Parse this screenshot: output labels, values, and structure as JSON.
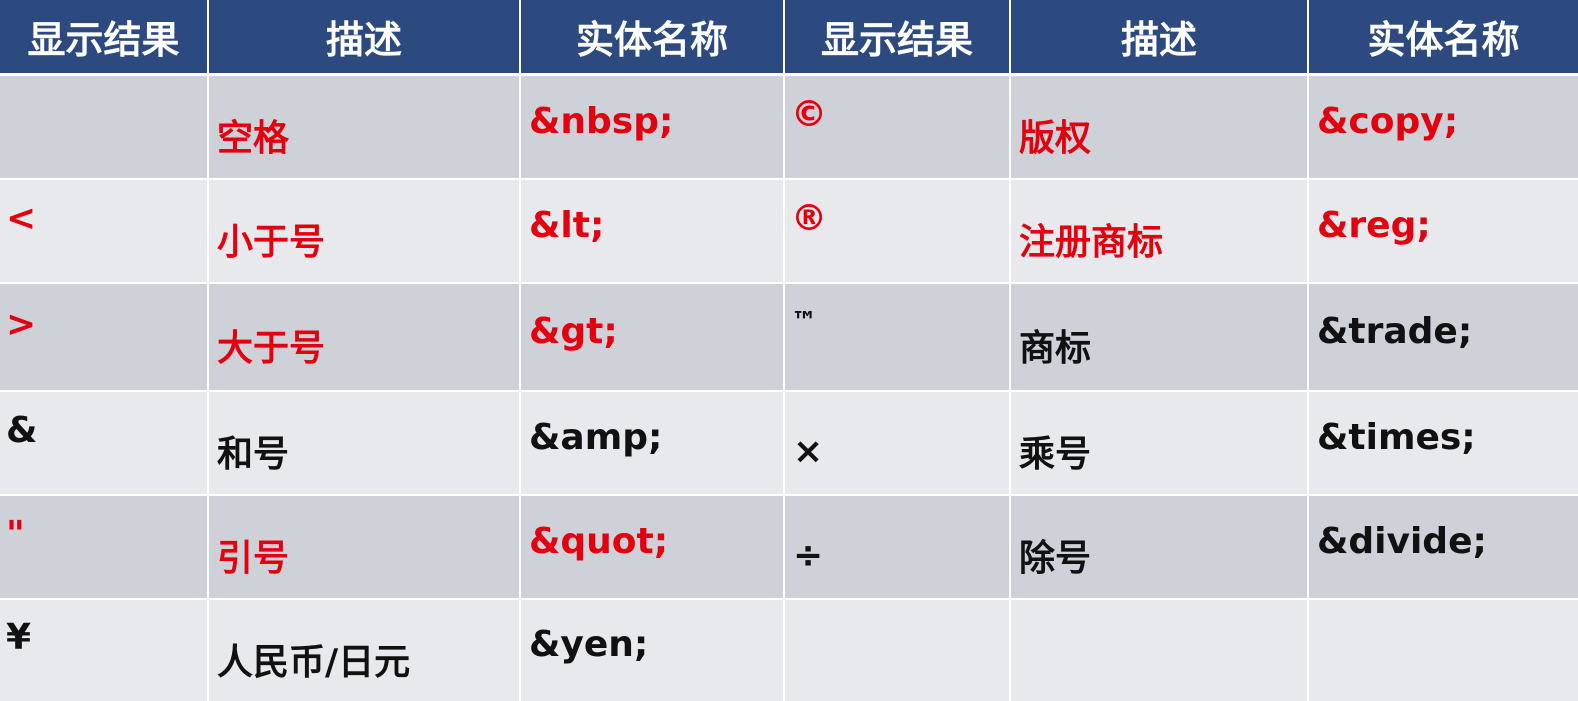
{
  "header": [
    "显示结果",
    "描述",
    "实体名称",
    "显示结果",
    "描述",
    "实体名称"
  ],
  "rows": [
    [
      "",
      "空格",
      "&nbsp;",
      "©",
      "版权",
      "&copy;"
    ],
    [
      "<",
      "小于号",
      "&lt;",
      "®",
      "注册商标",
      "&reg;"
    ],
    [
      ">",
      "大于号",
      "&gt;",
      "™",
      "商标",
      "&trade;"
    ],
    [
      "&",
      "和号",
      "&amp;",
      "×",
      "乘号",
      "&times;"
    ],
    [
      "\"",
      "引号",
      "&quot;",
      "÷",
      "除号",
      "&divide;"
    ],
    [
      "¥",
      "人民币/日元",
      "&yen;",
      "",
      "",
      ""
    ]
  ],
  "colors": {
    "header_bg": "#2c4a7f",
    "header_text": "#ffffff",
    "row_odd": "#cfd1d8",
    "row_even": "#e8e9ec",
    "highlight_text": "#e3000f",
    "normal_text": "#111111"
  }
}
